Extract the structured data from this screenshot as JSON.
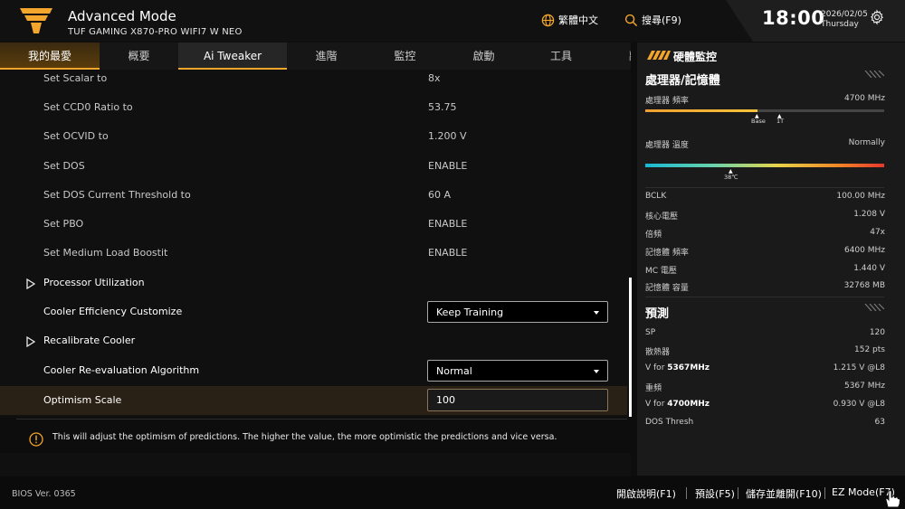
{
  "header": {
    "title": "Advanced Mode",
    "board": "TUF GAMING X870-PRO WIFI7 W NEO",
    "language": "繁體中文",
    "search": "搜尋(F9)",
    "time": "18:00",
    "date": "2026/02/05",
    "weekday": "Thursday",
    "accent_color": "#f4a52c"
  },
  "tabs": [
    {
      "label": "我的最愛"
    },
    {
      "label": "概要"
    },
    {
      "label": "Ai Tweaker"
    },
    {
      "label": "進階"
    },
    {
      "label": "監控"
    },
    {
      "label": "啟動"
    },
    {
      "label": "工具"
    },
    {
      "label": "離"
    }
  ],
  "settings": [
    {
      "label": "Set Scalar to",
      "value": "8x"
    },
    {
      "label": "Set CCD0 Ratio to",
      "value": "53.75"
    },
    {
      "label": "Set OCVID to",
      "value": "1.200 V"
    },
    {
      "label": "Set DOS",
      "value": "ENABLE"
    },
    {
      "label": "Set DOS Current Threshold to",
      "value": "60 A"
    },
    {
      "label": "Set PBO",
      "value": "ENABLE"
    },
    {
      "label": "Set Medium Load Boostit",
      "value": "ENABLE"
    },
    {
      "label": "Processor Utilization"
    },
    {
      "label": "Cooler Efficiency Customize",
      "value": "Keep Training"
    },
    {
      "label": "Recalibrate Cooler"
    },
    {
      "label": "Cooler Re-evaluation Algorithm",
      "value": "Normal"
    },
    {
      "label": "Optimism Scale",
      "value": "100"
    }
  ],
  "help_text": "This will adjust the optimism of predictions. The higher the value, the more optimistic the predictions and vice versa.",
  "monitor": {
    "title": "硬體監控",
    "cpu_section": "處理器/記憶體",
    "cpu_freq_label": "處理器 頻率",
    "cpu_freq_value": "4700 MHz",
    "cpu_freq_fraction": 0.47,
    "freq_base_label": "Base",
    "freq_1t_label": "1T",
    "cpu_temp_label": "處理器 溫度",
    "cpu_temp_status": "Normally",
    "cpu_temp_value": "38℃",
    "cpu_temp_fraction": 0.36,
    "items": [
      {
        "label": "BCLK",
        "value": "100.00 MHz"
      },
      {
        "label": "核心電壓",
        "value": "1.208 V"
      },
      {
        "label": "倍頻",
        "value": "47x"
      },
      {
        "label": "記憶體 頻率",
        "value": "6400 MHz"
      },
      {
        "label": "MC 電壓",
        "value": "1.440 V"
      },
      {
        "label": "記憶體 容量",
        "value": "32768 MB"
      }
    ],
    "predict_section": "預測",
    "predict": [
      {
        "label": "SP",
        "value": "120"
      },
      {
        "label": "散熱器",
        "value": "152 pts"
      },
      {
        "label_pre": "V for ",
        "label_em": "5367MHz",
        "value": "1.215 V @L8"
      },
      {
        "label": "重頻",
        "value": "5367 MHz"
      },
      {
        "label_pre": "V for ",
        "label_em": "4700MHz",
        "value": "0.930 V @L8"
      },
      {
        "label": "DOS Thresh",
        "value": "63"
      }
    ]
  },
  "footer": {
    "bios_version": "BIOS Ver. 0365",
    "help": "開啟說明(F1)",
    "defaults": "預設(F5)",
    "save_exit": "儲存並離開(F10)",
    "ez_mode": "EZ Mode(F7)"
  }
}
